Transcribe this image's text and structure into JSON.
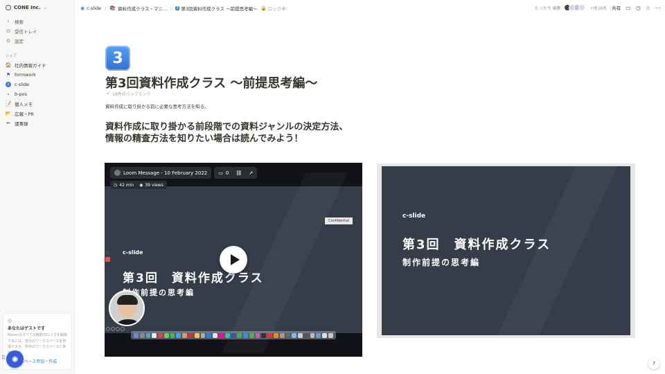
{
  "workspace": {
    "name": "CONE Inc."
  },
  "sidebar": {
    "nav": [
      {
        "icon": "search-icon",
        "label": "検索"
      },
      {
        "icon": "inbox-icon",
        "label": "受信トレイ"
      },
      {
        "icon": "settings-icon",
        "label": "設定"
      }
    ],
    "section_label": "シェア",
    "pages": [
      {
        "icon": "house-emoji-icon",
        "label": "社内情報ガイド"
      },
      {
        "icon": "formwork-flag-icon",
        "label": "formwork"
      },
      {
        "icon": "c-slide-icon",
        "label": "c-slide"
      },
      {
        "icon": "b-pos-icon",
        "label": "b-pos"
      },
      {
        "icon": "memo-icon",
        "label": "個人メモ"
      },
      {
        "icon": "pr-folder-icon",
        "label": "広報・PR"
      },
      {
        "icon": "pencil-icon",
        "label": "議事録"
      }
    ],
    "guest": {
      "title": "あなたはゲストです",
      "text": "Notionのすべての機能のロックを解除するには、自分のワークスペースを作成するか、既存のワークスペースに参加します",
      "button": "スペース参加・作成"
    }
  },
  "breadcrumbs": [
    {
      "icon": "c-slide-icon",
      "label": "c-slide"
    },
    {
      "icon": "book-icon",
      "label": "資料作成クラス・マニ..."
    },
    {
      "icon": "keycap-3-icon",
      "label": "第3回資料作成クラス 〜前提思考編〜"
    }
  ],
  "lock_label": "ロック中",
  "topbar": {
    "edited": "たった今 編集",
    "viewers": "+他18名",
    "share": "共有"
  },
  "page": {
    "icon_text": "3",
    "title": "第3回資料作成クラス 〜前提思考編〜",
    "backlinks": "16件のバックリンク",
    "description": "資料作成に取り掛かる前に必要な思考方法を知る。",
    "heading_line1": "資料作成に取り掛かる前段階での資料ジャンルの決定方法、",
    "heading_line2": "情報の精査方法を知りたい場合は読んでみよう！"
  },
  "video": {
    "title": "Loom Message - 10 February 2022",
    "comments": "0",
    "duration": "42 min",
    "views": "39 views",
    "confidential": "Confidential",
    "brand": "c-slide",
    "slide_title": "第3回　資料作成クラス",
    "slide_subtitle": "制作前提の思考編"
  },
  "slide_embed": {
    "brand": "c-slide",
    "title": "第3回　資料作成クラス",
    "subtitle": "制作前提の思考編"
  },
  "help": "?"
}
